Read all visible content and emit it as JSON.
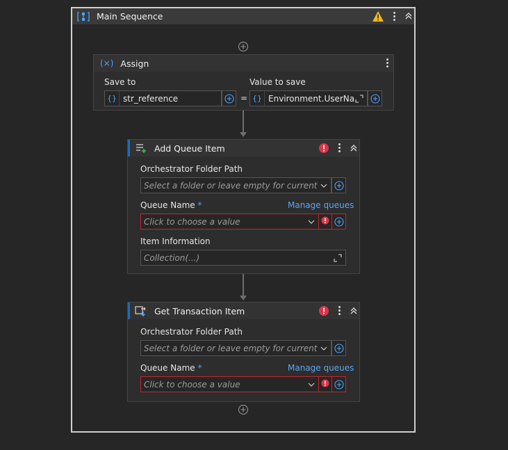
{
  "sequence": {
    "title": "Main Sequence"
  },
  "assign": {
    "title": "Assign",
    "save_to_label": "Save to",
    "value_to_save_label": "Value to save",
    "save_to_value": "str_reference",
    "value_to_save_value": "Environment.UserNam",
    "equals": "=",
    "curly": "{}"
  },
  "add_queue_item": {
    "title": "Add Queue Item",
    "folder_path_label": "Orchestrator Folder Path",
    "folder_path_placeholder": "Select a folder or leave empty for current workspa",
    "queue_name_label": "Queue Name",
    "required_mark": "*",
    "manage_queues": "Manage queues",
    "queue_name_placeholder": "Click to choose a value",
    "item_info_label": "Item Information",
    "item_info_value": "Collection(...)"
  },
  "get_transaction_item": {
    "title": "Get Transaction Item",
    "folder_path_label": "Orchestrator Folder Path",
    "folder_path_placeholder": "Select a folder or leave empty for current workspa",
    "queue_name_label": "Queue Name",
    "required_mark": "*",
    "manage_queues": "Manage queues",
    "queue_name_placeholder": "Click to choose a value"
  },
  "colors": {
    "background": "#262626",
    "accent": "#1e6bb8",
    "error": "#c4262e",
    "warning": "#f2b824",
    "link": "#59a7f0"
  },
  "icons": {
    "sequence": "sequence-icon",
    "warning": "warning-icon",
    "assign": "variable-x-icon",
    "add_queue": "add-queue-item-icon",
    "get_transaction": "get-transaction-item-icon",
    "error": "error-icon",
    "add": "add-circle-icon",
    "expand": "expand-icon",
    "chevron": "chevron-down-icon"
  }
}
